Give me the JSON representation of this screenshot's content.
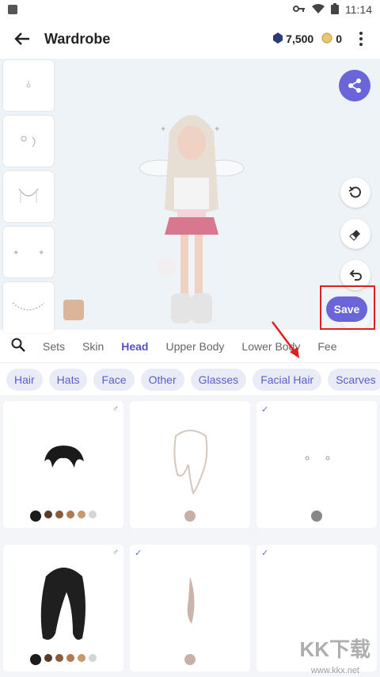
{
  "status": {
    "time": "11:14"
  },
  "appbar": {
    "title": "Wardrobe",
    "gems": "7,500",
    "coins": "0"
  },
  "stage": {
    "skin_color": "#dcb49a",
    "save_label": "Save"
  },
  "category_tabs": [
    "Sets",
    "Skin",
    "Head",
    "Upper Body",
    "Lower Body",
    "Fee"
  ],
  "active_tab": "Head",
  "chips": [
    "Hair",
    "Hats",
    "Face",
    "Other",
    "Glasses",
    "Facial Hair",
    "Scarves"
  ],
  "colors": {
    "accent": "#6a65d8",
    "highlight": "#e02020"
  },
  "items": [
    {
      "check": "",
      "gender": "♂",
      "colors": [
        "#1c1c1c",
        "#5a3a2a",
        "#8b5a3c",
        "#b07a50",
        "#c69a6a",
        "#d5d5d5"
      ]
    },
    {
      "check": "",
      "gender": "",
      "colors": [
        "#c8b0a6"
      ]
    },
    {
      "check": "✓",
      "gender": "",
      "colors": [
        "#888888"
      ]
    },
    {
      "check": "",
      "gender": "♂",
      "colors": [
        "#1c1c1c",
        "#5a3a2a",
        "#8b5a3c",
        "#b07a50",
        "#c69a6a",
        "#d5d5d5"
      ]
    },
    {
      "check": "✓",
      "gender": "",
      "colors": [
        "#c8b0a6"
      ]
    },
    {
      "check": "✓",
      "gender": "",
      "colors": []
    }
  ],
  "watermark": {
    "text": "KK下载",
    "url": "www.kkx.net"
  }
}
